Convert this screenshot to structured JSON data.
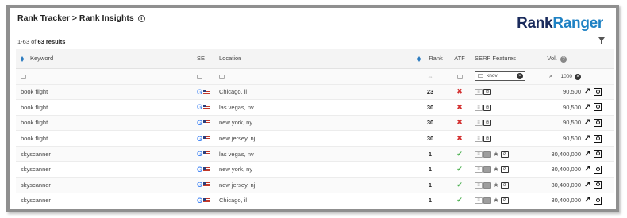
{
  "header": {
    "breadcrumb": "Rank Tracker > Rank Insights",
    "logo_rank": "Rank",
    "logo_ranger": "Ranger",
    "info_icon": "info-icon"
  },
  "results": {
    "prefix": "1-63 of ",
    "count": "63 results"
  },
  "columns": {
    "keyword": "Keyword",
    "se": "SE",
    "location": "Location",
    "rank": "Rank",
    "atf": "ATF",
    "serp": "SERP Features",
    "vol": "Vol."
  },
  "filters": {
    "serp_value": "knov",
    "vol_op": ">",
    "vol_value": "1000"
  },
  "rows": [
    {
      "keyword": "book flight",
      "location": "Chicago, il",
      "rank": "23",
      "atf": false,
      "serp": [
        "plain",
        "link"
      ],
      "vol": "90,500"
    },
    {
      "keyword": "book flight",
      "location": "las vegas, nv",
      "rank": "30",
      "atf": false,
      "serp": [
        "plain",
        "link"
      ],
      "vol": "90,500"
    },
    {
      "keyword": "book flight",
      "location": "new york, ny",
      "rank": "30",
      "atf": false,
      "serp": [
        "plain",
        "link"
      ],
      "vol": "90,500"
    },
    {
      "keyword": "book flight",
      "location": "new jersey, nj",
      "rank": "30",
      "atf": false,
      "serp": [
        "plain",
        "link"
      ],
      "vol": "90,500"
    },
    {
      "keyword": "skyscanner",
      "location": "las vegas, nv",
      "rank": "1",
      "atf": true,
      "serp": [
        "plain",
        "dark",
        "star",
        "link"
      ],
      "vol": "30,400,000"
    },
    {
      "keyword": "skyscanner",
      "location": "new york, ny",
      "rank": "1",
      "atf": true,
      "serp": [
        "plain",
        "dark",
        "star",
        "link"
      ],
      "vol": "30,400,000"
    },
    {
      "keyword": "skyscanner",
      "location": "new jersey, nj",
      "rank": "1",
      "atf": true,
      "serp": [
        "plain",
        "dark",
        "star",
        "link"
      ],
      "vol": "30,400,000"
    },
    {
      "keyword": "skyscanner",
      "location": "Chicago, il",
      "rank": "1",
      "atf": true,
      "serp": [
        "plain",
        "dark",
        "star",
        "link"
      ],
      "vol": "30,400,000"
    }
  ],
  "colors": {
    "brand_dark": "#1a2b5c",
    "brand_light": "#1f82c4",
    "atf_no": "#d32f2f",
    "atf_yes": "#4caf50"
  }
}
